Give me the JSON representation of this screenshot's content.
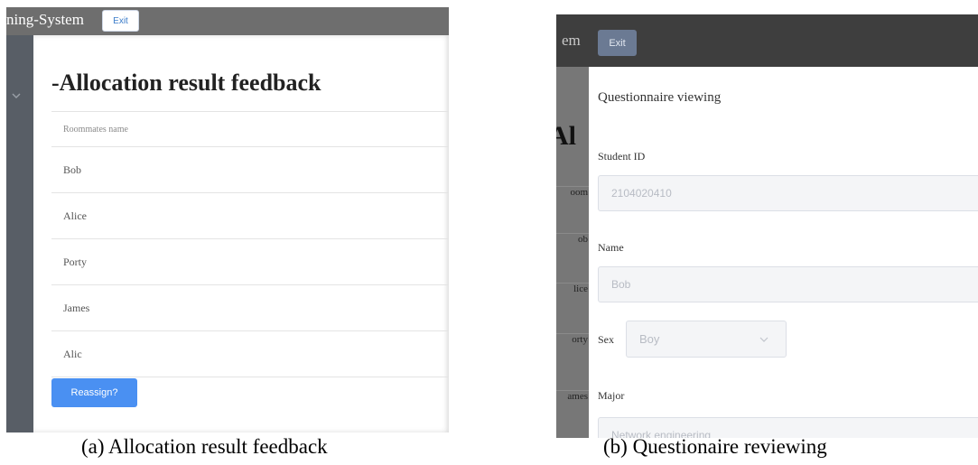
{
  "panel_a": {
    "app_title": "ning-System",
    "exit_label": "Exit",
    "page_title": "-Allocation result feedback",
    "table": {
      "header": "Roommates name",
      "rows": [
        "Bob",
        "Alice",
        "Porty",
        "James",
        "Alic"
      ]
    },
    "reassign_label": "Reassign?"
  },
  "panel_b": {
    "app_title": "em",
    "exit_label": "Exit",
    "background_fragments": {
      "title": "Al",
      "rows": [
        "oom",
        "ob",
        "lice",
        "orty",
        "ames"
      ]
    },
    "modal": {
      "title": "Questionnaire viewing",
      "student_id_label": "Student ID",
      "student_id_value": "2104020410",
      "name_label": "Name",
      "name_value": "Bob",
      "sex_label": "Sex",
      "sex_value": "Boy",
      "major_label": "Major",
      "major_value": "Network engineering"
    }
  },
  "captions": {
    "a": "(a) Allocation result feedback",
    "b": "(b) Questionaire reviewing"
  },
  "colors": {
    "primary": "#4a90f2",
    "header_a": "#6e6e6e",
    "header_b": "#3e3e3e",
    "sidebar": "#585e66"
  },
  "icons": [
    "chevron-down-icon"
  ]
}
